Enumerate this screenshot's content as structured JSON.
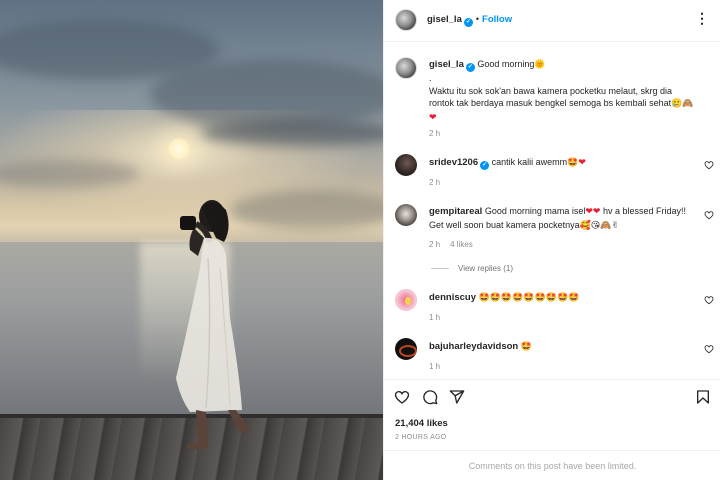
{
  "post": {
    "author": "gisel_la",
    "follow_label": "Follow",
    "separator": "•",
    "more_icon": "more-horizontal-icon"
  },
  "caption": {
    "username": "gisel_la",
    "line1": "Good morning",
    "line1_emoji": "🌞",
    "dot": ".",
    "body": "Waktu itu sok sok'an bawa kamera pocketku melaut, skrg dia rontok tak berdaya masuk bengkel semoga bs kembali sehat",
    "body_emoji": "🥲🙈",
    "body_heart": "❤",
    "time": "2 h"
  },
  "comments": [
    {
      "username": "sridev1206",
      "verified": true,
      "text": "cantik kalii awemm",
      "emoji": "🤩",
      "heart": "❤",
      "time": "2 h",
      "likes": ""
    },
    {
      "username": "gempitareal",
      "verified": false,
      "text": "Good morning mama isel",
      "hearts": "❤❤",
      "text2": " hv a blessed Friday!! Get well soon buat kamera pocketnya",
      "emoji": "🥰😘🙈✌",
      "time": "2 h",
      "likes": "4 likes"
    },
    {
      "username": "denniscuy",
      "verified": false,
      "text": "",
      "emoji": "🤩🤩🤩🤩🤩🤩🤩🤩🤩",
      "time": "1 h",
      "likes": ""
    },
    {
      "username": "bajuharleydavidson",
      "verified": false,
      "text": "",
      "emoji": "🤩",
      "time": "1 h",
      "likes": ""
    }
  ],
  "view_replies": "View replies (1)",
  "actions": {
    "like_icon": "heart-icon",
    "comment_icon": "comment-icon",
    "share_icon": "share-icon",
    "save_icon": "bookmark-icon"
  },
  "likes_count": "21,404 likes",
  "posted_ago": "2 HOURS AGO",
  "comments_limited": "Comments on this post have been limited.",
  "colors": {
    "accent": "#0095f6",
    "muted": "#8e8e8e",
    "heart": "#ed1c33"
  }
}
